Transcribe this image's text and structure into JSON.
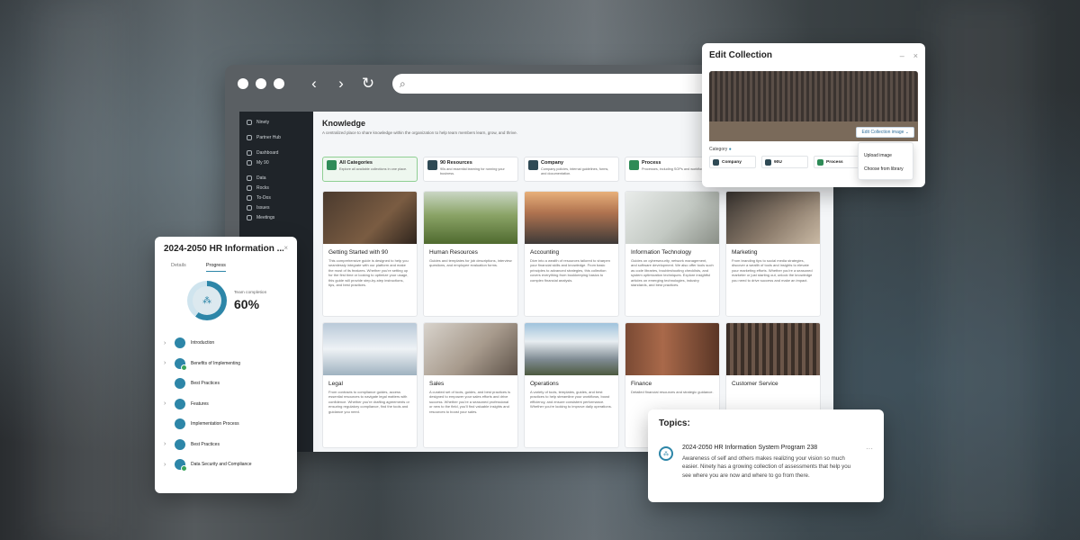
{
  "browser": {
    "nav_back": "‹",
    "nav_forward": "›",
    "nav_reload": "↻",
    "search_icon": "⌕"
  },
  "sidebar": {
    "brand": "Ninety",
    "items": [
      {
        "label": "Partner Hub"
      },
      {
        "label": "Dashboard"
      },
      {
        "label": "My 90"
      },
      {
        "label": "Data"
      },
      {
        "label": "Rocks"
      },
      {
        "label": "To-Dos"
      },
      {
        "label": "Issues"
      },
      {
        "label": "Meetings"
      }
    ]
  },
  "knowledge": {
    "title": "Knowledge",
    "subtitle": "A centralized place to share knowledge within the organization to help team members learn, grow, and thrive.",
    "categories": [
      {
        "title": "All Categories",
        "desc": "Explore all available collections in one place.",
        "icon": "folder-icon"
      },
      {
        "title": "90 Resources",
        "desc": "90s and essential learning for running your business.",
        "icon": "book-icon"
      },
      {
        "title": "Company",
        "desc": "Company policies, internal guidelines, forms, and documentation.",
        "icon": "building-icon"
      },
      {
        "title": "Process",
        "desc": "Processes, including SOPs and workflows.",
        "icon": "process-icon"
      }
    ],
    "cards": [
      {
        "title": "Getting Started with 90",
        "desc": "This comprehensive guide is designed to help you seamlessly integrate with our platform and make the most of its features. Whether you're setting up for the first time or looking to optimize your usage, this guide will provide step-by-step instructions, tips, and best practices."
      },
      {
        "title": "Human Resources",
        "desc": "Guides and templates for job descriptions, interview questions, and employee evaluation forms."
      },
      {
        "title": "Accounting",
        "desc": "Dive into a wealth of resources tailored to sharpen your financial skills and knowledge. From basic principles to advanced strategies, this collection covers everything from bookkeeping basics to complex financial analysis."
      },
      {
        "title": "Information Technology",
        "desc": "Guides on cybersecurity, network management, and software development. We also offer tools such as code libraries, troubleshooting checklists, and system optimization techniques. Explore insightful articles on emerging technologies, industry standards, and best practices."
      },
      {
        "title": "Marketing",
        "desc": "From branding tips to social media strategies, discover a wealth of tools and insights to elevate your marketing efforts. Whether you're a seasoned marketer or just starting out, unlock the knowledge you need to drive success and make an impact."
      },
      {
        "title": "Legal",
        "desc": "From contracts to compliance guides, access essential resources to navigate legal matters with confidence. Whether you're drafting agreements or ensuring regulatory compliance, find the tools and guidance you need."
      },
      {
        "title": "Sales",
        "desc": "A curated set of tools, guides, and best practices is designed to empower your sales efforts and drive success. Whether you're a seasoned professional or new to the field, you'll find valuable insights and resources to boost your sales."
      },
      {
        "title": "Operations",
        "desc": "A variety of tools, templates, guides, and best practices to help streamline your workflows, boost efficiency, and ensure consistent performance. Whether you're looking to improve daily operations."
      },
      {
        "title": "Finance",
        "desc": "Detailed financial resources and strategic guidance."
      },
      {
        "title": "Customer Service",
        "desc": ""
      }
    ]
  },
  "edit_collection": {
    "title": "Edit Collection",
    "minimize": "–",
    "close": "×",
    "button": "Edit Collection image",
    "category_label": "Category",
    "categories": [
      "Company",
      "90U",
      "Process"
    ],
    "menu": [
      "Upload image",
      "Choose from library"
    ]
  },
  "hr_panel": {
    "title": "2024-2050 HR Information ...",
    "close": "×",
    "tabs": [
      "Details",
      "Progress"
    ],
    "completion_label": "Team completion",
    "completion_value": "60%",
    "completion_fraction": 0.6,
    "modules": [
      {
        "label": "Introduction",
        "done": false,
        "expandable": true
      },
      {
        "label": "Benefits of Implementing",
        "done": true,
        "expandable": true
      },
      {
        "label": "Best Practices",
        "done": false,
        "expandable": false
      },
      {
        "label": "Features",
        "done": false,
        "expandable": true
      },
      {
        "label": "Implementation Process",
        "done": false,
        "expandable": false
      },
      {
        "label": "Best Practices",
        "done": false,
        "expandable": true
      },
      {
        "label": "Data Security and Compliance",
        "done": true,
        "expandable": true
      }
    ]
  },
  "topics": {
    "title": "Topics:",
    "name": "2024-2050 HR Information System Program 238",
    "text": "Awareness of self and others makes realizing your vision so much easier. Ninety has a growing collection of assessments that help you see where you are now and where to go from there.",
    "more": "···"
  },
  "colors": {
    "accent": "#2d86a8",
    "success": "#3aa55b",
    "sidebar_bg": "#1f2429"
  }
}
